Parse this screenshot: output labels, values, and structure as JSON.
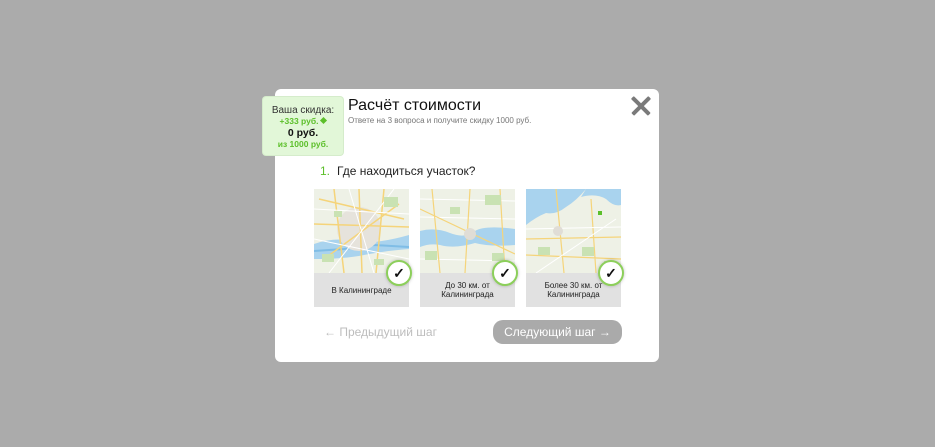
{
  "discount": {
    "label": "Ваша скидка:",
    "plus": "+333 руб.",
    "current": "0 руб.",
    "of_total": "из 1000 руб."
  },
  "header": {
    "title": "Расчёт стоимости",
    "subtitle": "Ответе на 3 вопроса и получите скидку 1000 руб."
  },
  "question": {
    "number": "1.",
    "text": "Где находиться участок?"
  },
  "options": [
    {
      "label": "В Калининграде",
      "icon": "map-city-icon"
    },
    {
      "label": "До 30 км. от Калининграда",
      "icon": "map-region-icon"
    },
    {
      "label": "Более 30 км. от Калининграда",
      "icon": "map-area-icon"
    }
  ],
  "nav": {
    "prev_label": "← Предыдущий шаг",
    "next_label": "Следующий шаг →"
  },
  "check_glyph": "✓",
  "colors": {
    "accent": "#5cbf2a",
    "overlay": "#ababab",
    "next_button": "#aaaaaa"
  }
}
